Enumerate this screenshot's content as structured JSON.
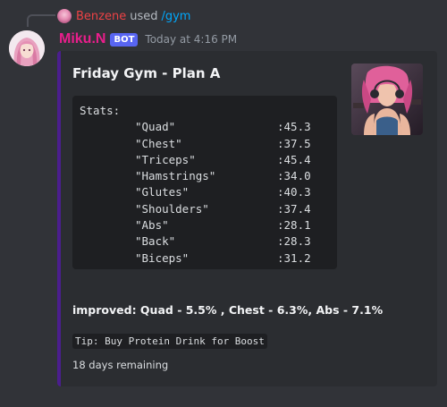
{
  "reply": {
    "user": "Benzene",
    "used_text": "used",
    "command": "/gym"
  },
  "message": {
    "username": "Miku.N",
    "badge": "BOT",
    "timestamp": "Today at 4:16 PM"
  },
  "embed": {
    "title": "Friday Gym - Plan A",
    "accent_color": "#4b1e8e",
    "stats_heading": "Stats:",
    "stats": [
      {
        "name": "\"Quad\"",
        "value": ":45.3"
      },
      {
        "name": "\"Chest\"",
        "value": ":37.5"
      },
      {
        "name": "\"Triceps\"",
        "value": ":45.4"
      },
      {
        "name": "\"Hamstrings\"",
        "value": ":34.0"
      },
      {
        "name": "\"Glutes\"",
        "value": ":40.3"
      },
      {
        "name": "\"Shoulders\"",
        "value": ":37.4"
      },
      {
        "name": "\"Abs\"",
        "value": ":28.1"
      },
      {
        "name": "\"Back\"",
        "value": ":28.3"
      },
      {
        "name": "\"Biceps\"",
        "value": ":31.2"
      }
    ],
    "improved": "improved: Quad - 5.5% , Chest - 6.3%, Abs - 7.1%",
    "tip": "Tip: Buy Protein Drink for Boost",
    "remaining": "18 days remaining"
  },
  "colors": {
    "background": "#313338",
    "embed_bg": "#2b2d31",
    "username": "#e91e8c",
    "reply_user": "#ed4245",
    "command_link": "#00a8fc",
    "bot_badge": "#5865f2"
  }
}
